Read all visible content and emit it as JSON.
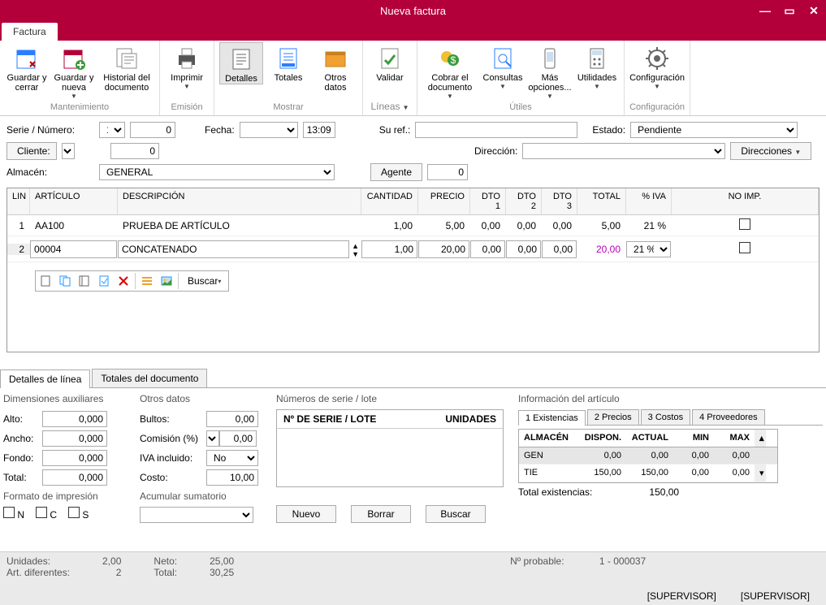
{
  "window": {
    "title": "Nueva factura"
  },
  "tabs": {
    "main": "Factura"
  },
  "ribbon": {
    "mantenimiento": {
      "caption": "Mantenimiento",
      "guardar_cerrar": "Guardar y cerrar",
      "guardar_nueva": "Guardar y nueva",
      "historial": "Historial del documento"
    },
    "emision": {
      "caption": "Emisión",
      "imprimir": "Imprimir"
    },
    "mostrar": {
      "caption": "Mostrar",
      "detalles": "Detalles",
      "totales": "Totales",
      "otros": "Otros datos"
    },
    "lineas": {
      "caption": "Líneas",
      "validar": "Validar"
    },
    "utiles": {
      "caption": "Útiles",
      "cobrar": "Cobrar el documento",
      "consultas": "Consultas",
      "mas": "Más opciones...",
      "utilidades": "Utilidades"
    },
    "config": {
      "caption": "Configuración",
      "configuracion": "Configuración"
    }
  },
  "form": {
    "serie_label": "Serie / Número:",
    "serie": "1",
    "numero": "0",
    "fecha_label": "Fecha:",
    "fecha": "",
    "hora": "13:09",
    "suref_label": "Su ref.:",
    "suref": "",
    "estado_label": "Estado:",
    "estado": "Pendiente",
    "cliente_label": "Cliente:",
    "cliente": "0",
    "direccion_label": "Dirección:",
    "direccion": "",
    "direcciones_btn": "Direcciones",
    "almacen_label": "Almacén:",
    "almacen": "GENERAL",
    "agente_btn": "Agente",
    "agente": "0"
  },
  "grid": {
    "headers": {
      "lin": "LIN",
      "art": "ARTÍCULO",
      "desc": "DESCRIPCIÓN",
      "cant": "CANTIDAD",
      "precio": "PRECIO",
      "dto1": "DTO 1",
      "dto2": "DTO 2",
      "dto3": "DTO 3",
      "total": "TOTAL",
      "iva": "% IVA",
      "noimp": "NO IMP."
    },
    "rows": [
      {
        "lin": "1",
        "art": "AA100",
        "desc": "PRUEBA DE ARTÍCULO",
        "cant": "1,00",
        "precio": "5,00",
        "dto1": "0,00",
        "dto2": "0,00",
        "dto3": "0,00",
        "total": "5,00",
        "iva": "21 %"
      },
      {
        "lin": "2",
        "art": "00004",
        "desc": "CONCATENADO",
        "cant": "1,00",
        "precio": "20,00",
        "dto1": "0,00",
        "dto2": "0,00",
        "dto3": "0,00",
        "total": "20,00",
        "iva": "21 %"
      }
    ],
    "buscar": "Buscar"
  },
  "lowerTabs": {
    "det": "Detalles de línea",
    "tot": "Totales del documento"
  },
  "dimensiones": {
    "title": "Dimensiones auxiliares",
    "alto_l": "Alto:",
    "alto": "0,000",
    "ancho_l": "Ancho:",
    "ancho": "0,000",
    "fondo_l": "Fondo:",
    "fondo": "0,000",
    "total_l": "Total:",
    "total": "0,000",
    "formato_l": "Formato de impresión",
    "n": "N",
    "c": "C",
    "s": "S"
  },
  "otros": {
    "title": "Otros datos",
    "bultos_l": "Bultos:",
    "bultos": "0,00",
    "comision_l": "Comisión (%)",
    "comision": "0,00",
    "iva_l": "IVA incluido:",
    "iva": "No",
    "costo_l": "Costo:",
    "costo": "10,00",
    "acum_l": "Acumular sumatorio"
  },
  "serial": {
    "title": "Números de serie / lote",
    "col1": "Nº DE SERIE / LOTE",
    "col2": "UNIDADES",
    "nuevo": "Nuevo",
    "borrar": "Borrar",
    "buscar": "Buscar"
  },
  "info": {
    "title": "Información del artículo",
    "tabs": {
      "ex": "1 Existencias",
      "pr": "2 Precios",
      "co": "3 Costos",
      "pv": "4 Proveedores"
    },
    "head": {
      "alm": "ALMACÉN",
      "disp": "DISPON.",
      "act": "ACTUAL",
      "min": "MIN",
      "max": "MAX"
    },
    "rows": [
      {
        "alm": "GEN",
        "disp": "0,00",
        "act": "0,00",
        "min": "0,00",
        "max": "0,00"
      },
      {
        "alm": "TIE",
        "disp": "150,00",
        "act": "150,00",
        "min": "0,00",
        "max": "0,00"
      }
    ],
    "total_l": "Total existencias:",
    "total": "150,00"
  },
  "bottom": {
    "unidades_l": "Unidades:",
    "unidades": "2,00",
    "artdif_l": "Art. diferentes:",
    "artdif": "2",
    "neto_l": "Neto:",
    "neto": "25,00",
    "total_l": "Total:",
    "total": "30,25",
    "prob_l": "Nº probable:",
    "prob": "1 - 000037"
  },
  "status": {
    "s1": "[SUPERVISOR]",
    "s2": "[SUPERVISOR]"
  }
}
